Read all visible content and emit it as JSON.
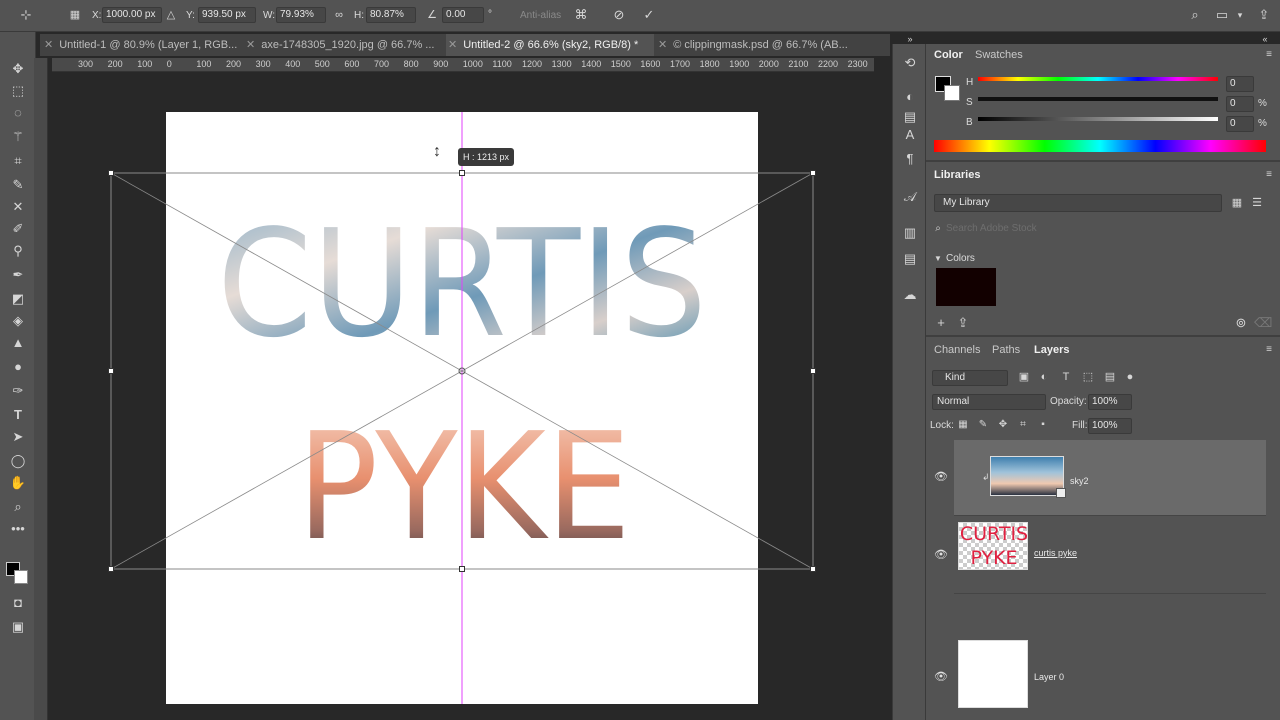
{
  "options_bar": {
    "x_label": "X:",
    "x_value": "1000.00 px",
    "y_label": "Y:",
    "y_value": "939.50 px",
    "w_label": "W:",
    "w_value": "79.93%",
    "h_label": "H:",
    "h_value": "80.87%",
    "angle_value": "0.00",
    "angle_unit": "°",
    "antialias": "Anti-alias"
  },
  "tabs": [
    {
      "label": "Untitled-1 @ 80.9% (Layer 1, RGB..."
    },
    {
      "label": "axe-1748305_1920.jpg @ 66.7% ..."
    },
    {
      "label": "Untitled-2 @ 66.6% (sky2, RGB/8) *"
    },
    {
      "label": "© clippingmask.psd @ 66.7% (AB..."
    }
  ],
  "ruler_ticks": [
    "300",
    "200",
    "100",
    "0",
    "100",
    "200",
    "300",
    "400",
    "500",
    "600",
    "700",
    "800",
    "900",
    "1000",
    "1100",
    "1200",
    "1300",
    "1400",
    "1500",
    "1600",
    "1700",
    "1800",
    "1900",
    "2000",
    "2100",
    "2200",
    "2300"
  ],
  "canvas": {
    "line1": "CURTIS",
    "line2": "PYKE",
    "tooltip": "H : 1213 px"
  },
  "color_panel": {
    "tab_color": "Color",
    "tab_swatches": "Swatches",
    "h_label": "H",
    "s_label": "S",
    "b_label": "B",
    "h_value": "0",
    "s_value": "0",
    "b_value": "0",
    "unit": "%"
  },
  "libraries": {
    "title": "Libraries",
    "library": "My Library",
    "search_placeholder": "Search Adobe Stock",
    "colors_label": "Colors"
  },
  "layers_panel": {
    "tab_channels": "Channels",
    "tab_paths": "Paths",
    "tab_layers": "Layers",
    "kind": "Kind",
    "blend": "Normal",
    "opacity_label": "Opacity:",
    "opacity_value": "100%",
    "lock_label": "Lock:",
    "fill_label": "Fill:",
    "fill_value": "100%",
    "layers": [
      {
        "name": "sky2"
      },
      {
        "name": "curtis pyke",
        "thumb_line1": "CURTIS",
        "thumb_line2": "PYKE"
      },
      {
        "name": "Layer 0"
      }
    ]
  },
  "colors": {
    "accent_guide": "#e040fb",
    "swatch": "#120000",
    "thumb_text": "#e02040"
  }
}
